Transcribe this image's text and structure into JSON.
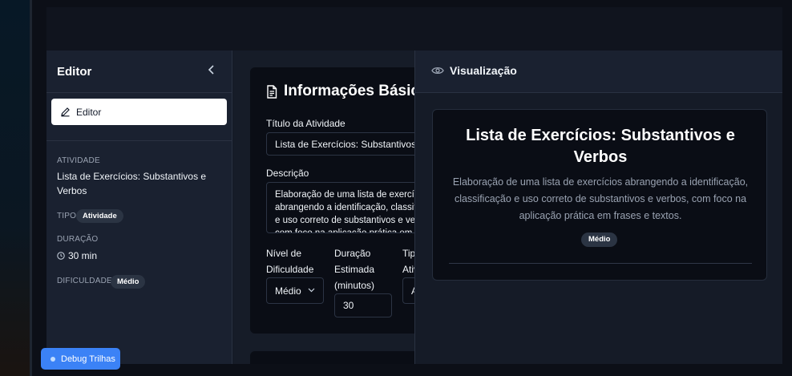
{
  "sidebar": {
    "title": "Editor",
    "collapse_icon": "chevron-left-icon",
    "editor_button": "Editor",
    "atividade_label": "ATIVIDADE",
    "atividade_value": "Lista de Exercícios: Substantivos e Verbos",
    "tipo_label": "TIPO",
    "tipo_badge": "Atividade",
    "duracao_label": "DURAÇÃO",
    "duracao_value": "30 min",
    "dificuldade_label": "DIFICULDADE",
    "dificuldade_badge": "Médio"
  },
  "form": {
    "section_title": "Informações Básicas",
    "titulo_label": "Título da Atividade",
    "titulo_value": "Lista de Exercícios: Substantivos e Verbos",
    "descricao_label": "Descrição",
    "descricao_value": "Elaboração de uma lista de exercícios abrangendo a identificação, classificação e uso correto de substantivos e verbos, com foco na aplicação prática em frases e textos.",
    "nivel_label": "Nível de Dificuldade",
    "nivel_value": "Médio",
    "duracao_label": "Duração Estimada (minutos)",
    "duracao_value": "30",
    "tipo_label": "Tipo de Atividade",
    "tipo_value": "Atividade"
  },
  "preview": {
    "title": "Visualização",
    "heading": "Lista de Exercícios: Substantivos e Verbos",
    "description": "Elaboração de uma lista de exercícios abrangendo a identificação, classificação e uso correto de substantivos e verbos, com foco na aplicação prática em frases e textos.",
    "badge": "Médio"
  },
  "debug_button": "Debug Trilhas",
  "colors": {
    "accent": "#3b82f6",
    "panel": "#1a2130",
    "card": "#0a0d15"
  }
}
